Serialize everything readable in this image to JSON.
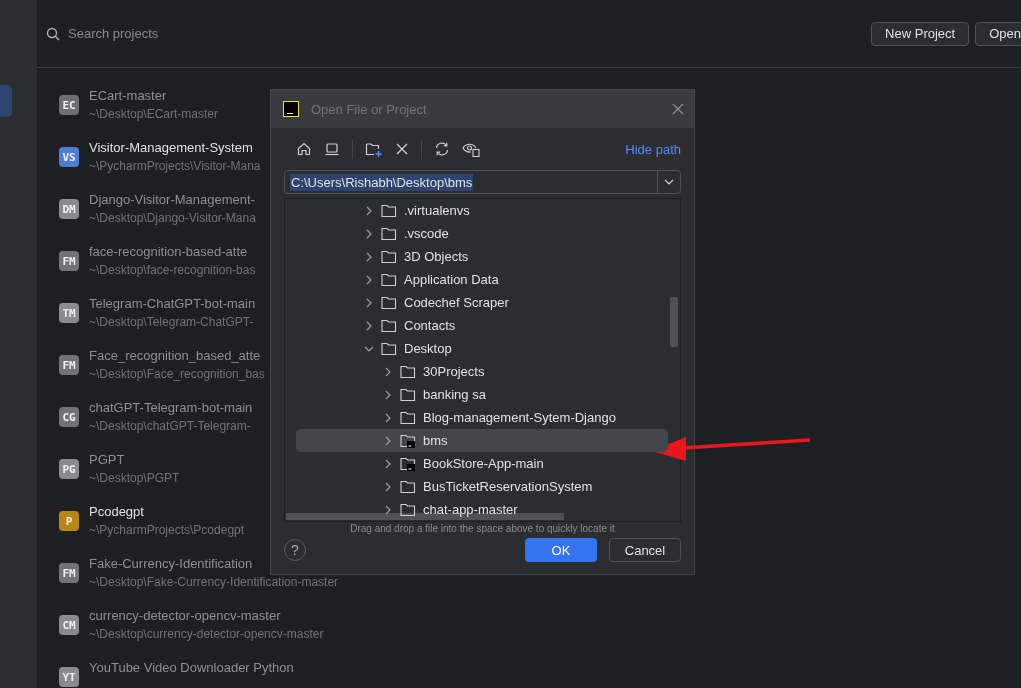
{
  "search": {
    "placeholder": "Search projects"
  },
  "buttons": [
    {
      "label": "New Project"
    },
    {
      "label": "Open"
    }
  ],
  "sidebar": {
    "items": [
      {
        "selected": true
      }
    ]
  },
  "projects": [
    {
      "initials": "EC",
      "color": "#6e6f73",
      "name": "ECart-master",
      "path": "~\\Desktop\\ECart-master",
      "available": false
    },
    {
      "initials": "VS",
      "color": "#4a7fd4",
      "name": "Visitor-Management-System",
      "path": "~\\PycharmProjects\\Visitor-Mana",
      "available": true
    },
    {
      "initials": "DM",
      "color": "#8a8b8e",
      "name": "Django-Visitor-Management-",
      "path": "~\\Desktop\\Django-Visitor-Mana",
      "available": false
    },
    {
      "initials": "FM",
      "color": "#727376",
      "name": "face-recognition-based-atte",
      "path": "~\\Desktop\\face-recognition-bas",
      "available": false
    },
    {
      "initials": "TM",
      "color": "#8a8b8e",
      "name": "Telegram-ChatGPT-bot-main",
      "path": "~\\Desktop\\Telegram-ChatGPT-",
      "available": false
    },
    {
      "initials": "FM",
      "color": "#727376",
      "name": "Face_recognition_based_atte",
      "path": "~\\Desktop\\Face_recognition_bas",
      "available": false
    },
    {
      "initials": "CG",
      "color": "#727376",
      "name": "chatGPT-Telegram-bot-main",
      "path": "~\\Desktop\\chatGPT-Telegram-",
      "available": false
    },
    {
      "initials": "PG",
      "color": "#8a8b8e",
      "name": "PGPT",
      "path": "~\\Desktop\\PGPT",
      "available": false
    },
    {
      "initials": "P",
      "color": "#b88612",
      "name": "Pcodegpt",
      "path": "~\\PycharmProjects\\Pcodegpt",
      "available": true
    },
    {
      "initials": "FM",
      "color": "#727376",
      "name": "Fake-Currency-Identification",
      "path": "~\\Desktop\\Fake-Currency-Identification-master",
      "available": false
    },
    {
      "initials": "CM",
      "color": "#8a8b8e",
      "name": "currency-detector-opencv-master",
      "path": "~\\Desktop\\currency-detector-opencv-master",
      "available": false
    },
    {
      "initials": "YT",
      "color": "#8a8b8e",
      "name": "YouTube Video Downloader Python",
      "available": false
    }
  ],
  "dialog": {
    "title": "Open File or Project",
    "hide_path_link": "Hide path",
    "path_field": {
      "value": "C:\\Users\\Rishabh\\Desktop\\bms"
    },
    "tree": [
      {
        "name": ".virtualenvs",
        "expanded": false,
        "selected": false
      },
      {
        "name": ".vscode",
        "expanded": false,
        "selected": false
      },
      {
        "name": "3D Objects",
        "expanded": false,
        "selected": false
      },
      {
        "name": "Application Data",
        "expanded": false,
        "selected": false
      },
      {
        "name": "Codechef Scraper",
        "expanded": false,
        "selected": false
      },
      {
        "name": "Contacts",
        "expanded": false,
        "selected": false
      },
      {
        "name": "Desktop",
        "expanded": true,
        "selected": false,
        "children": [
          {
            "name": "30Projects",
            "expanded": false,
            "selected": false
          },
          {
            "name": "banking sa",
            "expanded": false,
            "selected": false
          },
          {
            "name": "Blog-management-Sytem-Django",
            "expanded": false,
            "selected": false
          },
          {
            "name": "bms",
            "expanded": false,
            "selected": true,
            "project": true
          },
          {
            "name": "BookStore-App-main",
            "expanded": false,
            "selected": false,
            "project": true
          },
          {
            "name": "BusTicketReservationSystem",
            "expanded": false,
            "selected": false
          },
          {
            "name": "chat-app-master",
            "expanded": false,
            "selected": false
          }
        ]
      }
    ],
    "hint": "Drag and drop a file into the space above to quickly locate it",
    "help_button": "?",
    "ok_button": "OK",
    "cancel_button": "Cancel"
  }
}
